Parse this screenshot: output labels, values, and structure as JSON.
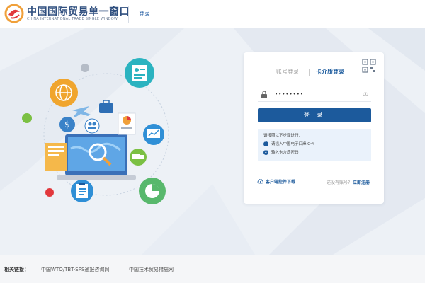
{
  "header": {
    "brand_cn": "中国国际贸易单一窗口",
    "brand_en": "CHINA INTERNATIONAL TRADE SINGLE WINDOW",
    "login_link": "登录"
  },
  "login_card": {
    "tabs": [
      {
        "label": "账号登录",
        "active": false
      },
      {
        "label": "卡介质登录",
        "active": true
      }
    ],
    "password_value": "••••••••",
    "submit_label": "登 录",
    "steps_title": "请按照以下步骤进行：",
    "steps": [
      {
        "num": "1",
        "text": "请插入中国电子口岸IC卡"
      },
      {
        "num": "2",
        "text": "输入卡介质密码"
      }
    ],
    "download_label": "客户端控件下载",
    "no_account_text": "还没有账号？",
    "register_label": "立即注册"
  },
  "footer": {
    "label": "相关链接：",
    "links": [
      "中国WTO/TBT-SPS通报咨询网",
      "中国技术贸易措施网"
    ]
  },
  "colors": {
    "brand_blue": "#1c5a9c",
    "accent_orange": "#f0a03a",
    "accent_red": "#e2383c",
    "accent_green": "#7bc043",
    "accent_teal": "#2bb3c0"
  }
}
